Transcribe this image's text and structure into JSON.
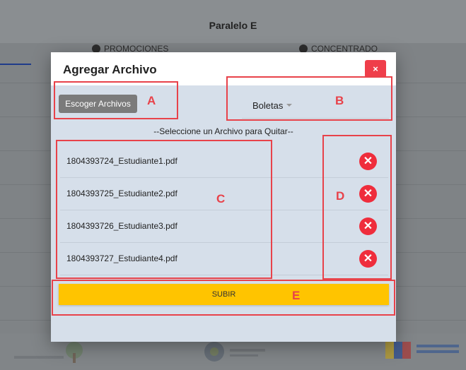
{
  "background": {
    "title": "Paralelo E",
    "tabs": [
      {
        "label": "PROMOCIONES",
        "icon": "check-circle-icon"
      },
      {
        "label": "CONCENTRADO",
        "icon": "list-circle-icon"
      }
    ]
  },
  "modal": {
    "title": "Agregar Archivo",
    "close_label": "×",
    "choose_files_label": "Escoger Archivos",
    "select": {
      "value": "Boletas"
    },
    "instruction": "--Seleccione un Archivo para Quitar--",
    "files": [
      {
        "name": "1804393724_Estudiante1.pdf"
      },
      {
        "name": "1804393725_Estudiante2.pdf"
      },
      {
        "name": "1804393726_Estudiante3.pdf"
      },
      {
        "name": "1804393727_Estudiante4.pdf"
      }
    ],
    "upload_label": "SUBIR"
  },
  "annotations": {
    "a": "A",
    "b": "B",
    "c": "C",
    "d": "D",
    "e": "E"
  },
  "colors": {
    "close": "#ef3e4a",
    "remove": "#ef2d3c",
    "upload": "#ffc400",
    "annotation": "#e8424a"
  }
}
